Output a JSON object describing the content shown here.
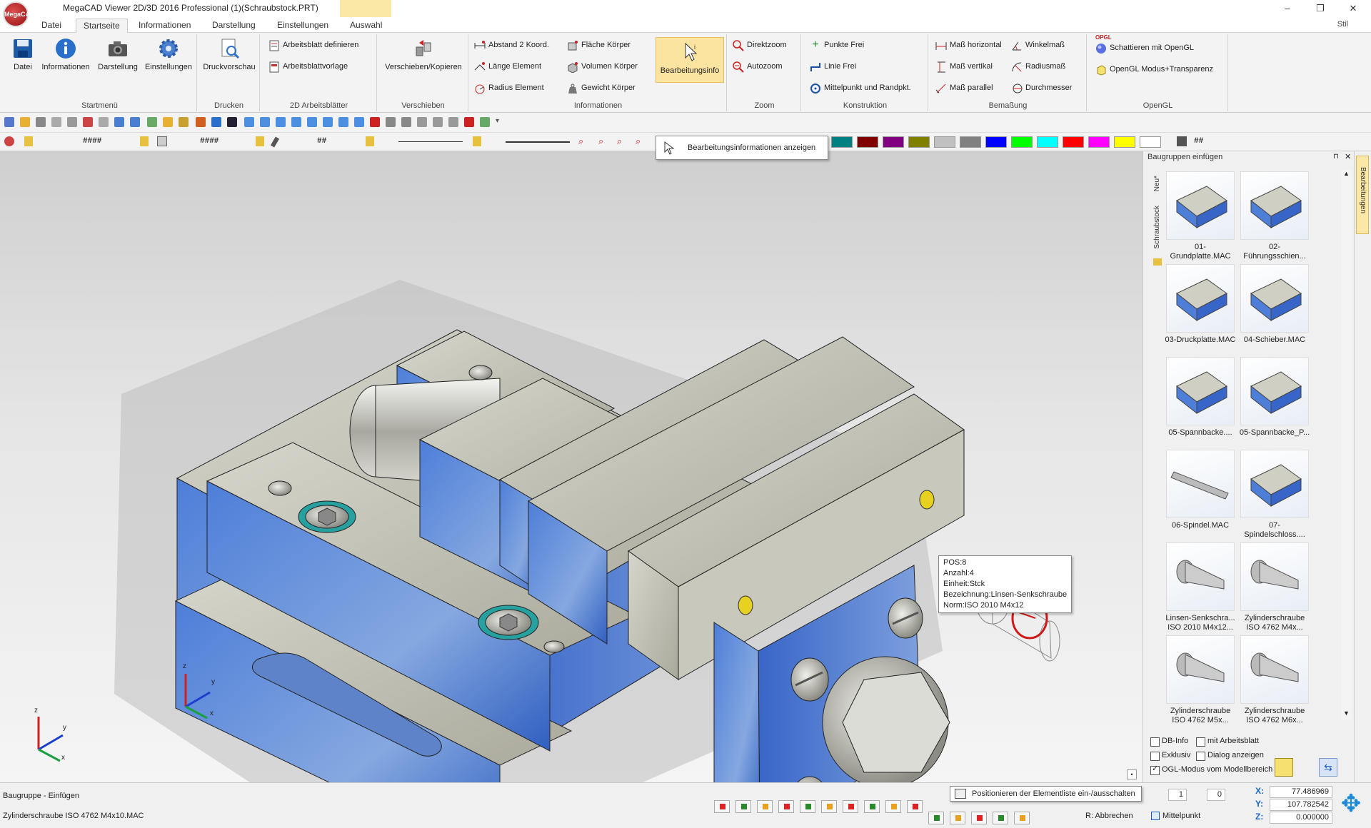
{
  "window": {
    "title": "MegaCAD Viewer 2D/3D 2016 Professional (1)(Schraubstock.PRT)",
    "logo_text": "MegaCAD",
    "minimize": "–",
    "maximize": "❐",
    "close": "✕"
  },
  "tabs": [
    "Datei",
    "Startseite",
    "Informationen",
    "Darstellung",
    "Einstellungen",
    "Auswahl"
  ],
  "active_tab": "Startseite",
  "stil_label": "Stil",
  "ribbon": {
    "startmenu": {
      "label": "Startmenü",
      "buttons": [
        "Datei",
        "Informationen",
        "Darstellung",
        "Einstellungen"
      ]
    },
    "drucken": {
      "label": "Drucken",
      "buttons": [
        "Druckvorschau"
      ]
    },
    "arbeitsblaetter": {
      "label": "2D Arbeitsblätter",
      "items": [
        "Arbeitsblatt definieren",
        "Arbeitsblattvorlage"
      ]
    },
    "verschieben": {
      "label": "Verschieben",
      "buttons": [
        "Verschieben/Kopieren"
      ]
    },
    "informationen": {
      "label": "Informationen",
      "col1": [
        "Abstand 2 Koord.",
        "Länge Element",
        "Radius Element"
      ],
      "col2": [
        "Fläche Körper",
        "Volumen Körper",
        "Gewicht Körper"
      ],
      "big": "Bearbeitungsinfo"
    },
    "zoom": {
      "label": "Zoom",
      "items": [
        "Direktzoom",
        "Autozoom"
      ]
    },
    "konstruktion": {
      "label": "Konstruktion",
      "items": [
        "Punkte Frei",
        "Linie Frei",
        "Mittelpunkt und Randpkt."
      ]
    },
    "bemassung": {
      "label": "Bemaßung",
      "col1": [
        "Maß horizontal",
        "Maß vertikal",
        "Maß parallel"
      ],
      "col2": [
        "Winkelmaß",
        "Radiusmaß",
        "Durchmesser"
      ]
    },
    "opengl": {
      "label": "OpenGL",
      "items": [
        "Schattieren mit OpenGL",
        "OpenGL Modus+Transparenz"
      ],
      "badge": "OPGL"
    }
  },
  "attrbar": {
    "hash1": "####",
    "hash2": "####",
    "hash3": "##",
    "hash4": "##"
  },
  "colors": [
    "#008080",
    "#800000",
    "#800080",
    "#808000",
    "#c0c0c0",
    "#808080",
    "#0000ff",
    "#00ff00",
    "#00ffff",
    "#ff0000",
    "#ff00ff",
    "#ffff00",
    "#ffffff"
  ],
  "tooltips": {
    "ribbon_tip": "Bearbeitungsinformationen anzeigen",
    "status_tip": "Positionieren der Elementliste ein-/ausschalten"
  },
  "part_info": [
    "POS:8",
    "Anzahl:4",
    "Einheit:Stck",
    "Bezeichnung:Linsen-Senkschraube",
    "Norm:ISO 2010 M4x12"
  ],
  "axes": {
    "x": "x",
    "y": "y",
    "z": "z"
  },
  "panel": {
    "title": "Baugruppen einfügen",
    "vtabs": [
      "Neu*",
      "Schraubstock"
    ],
    "right_vtab": "Bearbeitungen",
    "items": [
      {
        "label": "01-Grundplatte.MAC"
      },
      {
        "label": "02-Führungsschien..."
      },
      {
        "label": "03-Druckplatte.MAC"
      },
      {
        "label": "04-Schieber.MAC"
      },
      {
        "label": "05-Spannbacke...."
      },
      {
        "label": "05-Spannbacke_P..."
      },
      {
        "label": "06-Spindel.MAC"
      },
      {
        "label": "07-Spindelschloss...."
      },
      {
        "label": "Linsen-Senkschra... ISO 2010 M4x12..."
      },
      {
        "label": "Zylinderschraube ISO 4762 M4x..."
      },
      {
        "label": "Zylinderschraube ISO 4762 M5x..."
      },
      {
        "label": "Zylinderschraube ISO 4762 M6x..."
      }
    ],
    "checkboxes": [
      {
        "label": "DB-Info",
        "checked": false
      },
      {
        "label": "mit Arbeitsblatt",
        "checked": false
      },
      {
        "label": "Exklusiv",
        "checked": false
      },
      {
        "label": "Dialog anzeigen",
        "checked": false
      },
      {
        "label": "OGL-Modus vom Modellbereich",
        "checked": true
      }
    ]
  },
  "status": {
    "line1": "Baugruppe - Einfügen",
    "line2": "Zylinderschraube ISO 4762 M4x10.MAC",
    "abbrechen": "R: Abbrechen",
    "mittelpunkt": "Mittelpunkt",
    "spin1": "1",
    "spin2": "0",
    "x_val": "77.486969",
    "y_val": "107.782542",
    "z_val": "0.000000",
    "x_label": "X:",
    "y_label": "Y:",
    "z_label": "Z:"
  }
}
